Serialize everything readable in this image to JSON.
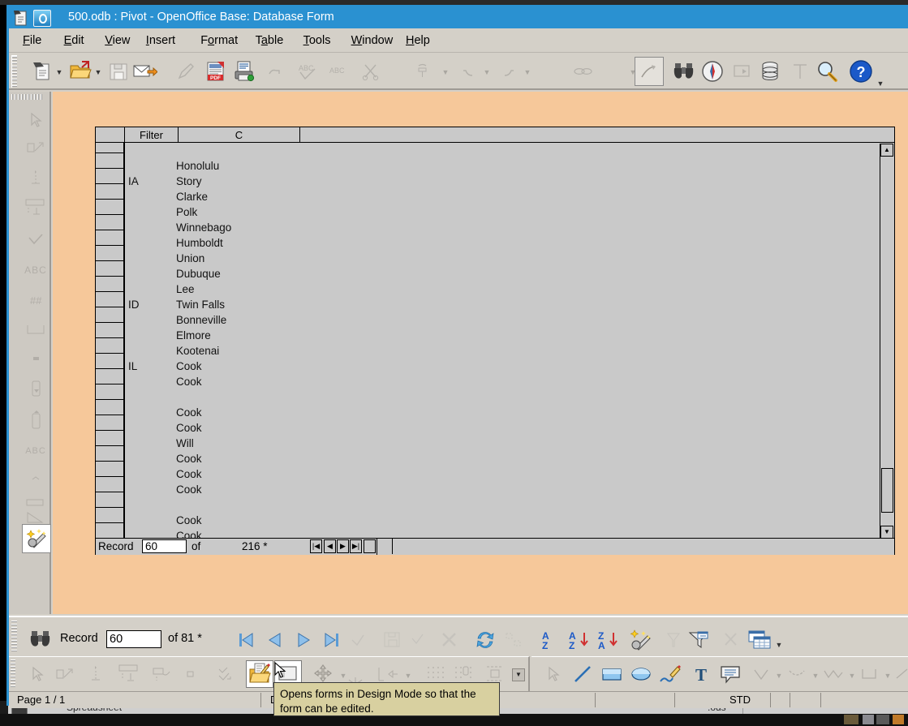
{
  "window": {
    "title": "500.odb : Pivot - OpenOffice Base: Database Form",
    "accent_color": "#2a91d1",
    "chrome_color": "#d4d0c8",
    "canvas_color": "#f6c89a"
  },
  "menubar": {
    "items": [
      {
        "label": "File",
        "accel": "F"
      },
      {
        "label": "Edit",
        "accel": "E"
      },
      {
        "label": "View",
        "accel": "V"
      },
      {
        "label": "Insert",
        "accel": "I"
      },
      {
        "label": "Format",
        "accel": "o"
      },
      {
        "label": "Table",
        "accel": "a"
      },
      {
        "label": "Tools",
        "accel": "T"
      },
      {
        "label": "Window",
        "accel": "W"
      },
      {
        "label": "Help",
        "accel": "H"
      }
    ]
  },
  "toolbar": {
    "buttons": [
      {
        "name": "new-document",
        "icon": "new-doc-icon",
        "enabled": true,
        "dropdown": true
      },
      {
        "name": "open-document",
        "icon": "open-folder-icon",
        "enabled": true,
        "dropdown": true
      },
      {
        "name": "save-document",
        "icon": "save-floppy-icon",
        "enabled": false,
        "dropdown": false
      },
      {
        "name": "send-email",
        "icon": "email-icon",
        "enabled": true,
        "dropdown": false
      },
      {
        "name": "edit-file",
        "icon": "edit-pencil-icon",
        "enabled": false,
        "dropdown": false
      },
      {
        "name": "export-pdf",
        "icon": "pdf-icon",
        "enabled": true,
        "dropdown": false
      },
      {
        "name": "print-file",
        "icon": "printer-icon",
        "enabled": true,
        "dropdown": false
      },
      {
        "name": "print-preview",
        "icon": "preview-icon",
        "enabled": false,
        "dropdown": false
      },
      {
        "name": "spelling",
        "icon": "abc-check-icon",
        "enabled": false,
        "dropdown": false
      },
      {
        "name": "autospellcheck",
        "icon": "abc-icon",
        "enabled": false,
        "dropdown": false
      },
      {
        "name": "cut",
        "icon": "scissors-icon",
        "enabled": false,
        "dropdown": false
      },
      {
        "name": "clone-formatting",
        "icon": "paintbrush-icon",
        "enabled": false,
        "dropdown": true
      },
      {
        "name": "undo",
        "icon": "undo-arrow-icon",
        "enabled": false,
        "dropdown": true
      },
      {
        "name": "redo",
        "icon": "redo-arrow-icon",
        "enabled": false,
        "dropdown": true
      },
      {
        "name": "hyperlink",
        "icon": "chain-link-icon",
        "enabled": false,
        "dropdown": true
      },
      {
        "name": "draw-functions",
        "icon": "draw-curve-icon",
        "enabled": true,
        "dropdown": false,
        "pressed": true
      },
      {
        "name": "find-and-replace",
        "icon": "binoculars-icon",
        "enabled": true,
        "dropdown": false
      },
      {
        "name": "navigator",
        "icon": "compass-icon",
        "enabled": true,
        "dropdown": false
      },
      {
        "name": "gallery",
        "icon": "gallery-icon",
        "enabled": false,
        "dropdown": false
      },
      {
        "name": "data-sources",
        "icon": "database-icon",
        "enabled": true,
        "dropdown": false
      },
      {
        "name": "formatting-marks",
        "icon": "pilcrow-icon",
        "enabled": false,
        "dropdown": false
      },
      {
        "name": "zoom",
        "icon": "magnifier-icon",
        "enabled": true,
        "dropdown": false
      },
      {
        "name": "help",
        "icon": "help-question-icon",
        "enabled": true,
        "dropdown": false
      }
    ],
    "overflow_label": "▼"
  },
  "left_toolbar": {
    "buttons": [
      {
        "name": "select-tool",
        "icon": "arrow-cursor-icon",
        "enabled": false
      },
      {
        "name": "design-mode-toggle",
        "icon": "design-mode-icon",
        "enabled": false
      },
      {
        "name": "label-field",
        "icon": "label-field-icon",
        "enabled": false
      },
      {
        "name": "text-box",
        "icon": "text-box-icon",
        "enabled": false
      },
      {
        "name": "check-box",
        "icon": "check-box-icon",
        "enabled": false
      },
      {
        "name": "formatted-field",
        "icon": "abc-field-icon",
        "enabled": false
      },
      {
        "name": "numeric-field",
        "icon": "numeric-field-icon",
        "enabled": false
      },
      {
        "name": "group-box",
        "icon": "group-box-icon",
        "enabled": false
      },
      {
        "name": "option-button",
        "icon": "option-button-icon",
        "enabled": false
      },
      {
        "name": "list-box",
        "icon": "list-box-icon",
        "enabled": false
      },
      {
        "name": "combo-box",
        "icon": "combo-box-icon",
        "enabled": false
      },
      {
        "name": "pattern-field",
        "icon": "pattern-field-icon",
        "enabled": false
      },
      {
        "name": "image-button",
        "icon": "image-button-icon",
        "enabled": false
      },
      {
        "name": "image-control",
        "icon": "image-control-icon",
        "enabled": false
      },
      {
        "name": "table-control",
        "icon": "table-control-icon",
        "enabled": false
      },
      {
        "name": "form-wizards",
        "icon": "magic-wand-icon",
        "enabled": true,
        "active": true
      }
    ],
    "expand_label": "▶"
  },
  "grid": {
    "columns": [
      {
        "key": "selector",
        "label": ""
      },
      {
        "key": "filter",
        "label": "Filter"
      },
      {
        "key": "c",
        "label": "C"
      },
      {
        "key": "blank",
        "label": ""
      }
    ],
    "rows": [
      {
        "filter": "",
        "c": ""
      },
      {
        "filter": "",
        "c": "Honolulu"
      },
      {
        "filter": "IA",
        "c": "Story"
      },
      {
        "filter": "",
        "c": "Clarke"
      },
      {
        "filter": "",
        "c": "Polk"
      },
      {
        "filter": "",
        "c": "Winnebago"
      },
      {
        "filter": "",
        "c": "Humboldt"
      },
      {
        "filter": "",
        "c": "Union"
      },
      {
        "filter": "",
        "c": "Dubuque"
      },
      {
        "filter": "",
        "c": "Lee"
      },
      {
        "filter": "ID",
        "c": "Twin Falls"
      },
      {
        "filter": "",
        "c": "Bonneville"
      },
      {
        "filter": "",
        "c": "Elmore"
      },
      {
        "filter": "",
        "c": "Kootenai"
      },
      {
        "filter": "IL",
        "c": "Cook"
      },
      {
        "filter": "",
        "c": "Cook"
      },
      {
        "filter": "",
        "c": ""
      },
      {
        "filter": "",
        "c": "Cook"
      },
      {
        "filter": "",
        "c": "Cook"
      },
      {
        "filter": "",
        "c": "Will"
      },
      {
        "filter": "",
        "c": "Cook"
      },
      {
        "filter": "",
        "c": "Cook"
      },
      {
        "filter": "",
        "c": "Cook"
      },
      {
        "filter": "",
        "c": ""
      },
      {
        "filter": "",
        "c": "Cook"
      },
      {
        "filter": "",
        "c": "Cook"
      }
    ],
    "navigation": {
      "record_label": "Record",
      "record_value": "60",
      "of_label": "of",
      "total": "216 *",
      "first_label": "⏮",
      "prev_label": "◀",
      "next_label": "▶",
      "last_label": "⏭"
    },
    "scrollbar": {
      "up_label": "▲",
      "down_label": "▼"
    }
  },
  "form_nav": {
    "search_icon": "binoculars-icon",
    "record_label": "Record",
    "record_value": "60",
    "of_label": "of 81 *",
    "buttons": [
      {
        "name": "first-record",
        "icon": "first-record-icon",
        "enabled": true
      },
      {
        "name": "previous-record",
        "icon": "prev-record-icon",
        "enabled": true
      },
      {
        "name": "next-record",
        "icon": "next-record-icon",
        "enabled": true
      },
      {
        "name": "last-record",
        "icon": "last-record-icon",
        "enabled": true
      },
      {
        "name": "new-record",
        "icon": "new-record-icon",
        "enabled": false
      },
      {
        "name": "save-record",
        "icon": "save-record-icon",
        "enabled": false
      },
      {
        "name": "undo-data-entry",
        "icon": "undo-entry-icon",
        "enabled": false
      },
      {
        "name": "delete-record",
        "icon": "delete-record-icon",
        "enabled": false
      },
      {
        "name": "refresh",
        "icon": "refresh-icon",
        "enabled": true
      },
      {
        "name": "refresh-control",
        "icon": "refresh-control-icon",
        "enabled": false
      },
      {
        "name": "sort",
        "icon": "sort-az-icon",
        "enabled": true
      },
      {
        "name": "sort-ascending",
        "icon": "sort-ascending-icon",
        "enabled": true
      },
      {
        "name": "sort-descending",
        "icon": "sort-descending-icon",
        "enabled": true
      },
      {
        "name": "autofilter",
        "icon": "autofilter-wand-icon",
        "enabled": true
      },
      {
        "name": "apply-filter",
        "icon": "apply-filter-icon",
        "enabled": false
      },
      {
        "name": "form-based-filter",
        "icon": "form-filter-icon",
        "enabled": true
      },
      {
        "name": "reset-filter",
        "icon": "reset-filter-icon",
        "enabled": false
      },
      {
        "name": "data-source-as-table",
        "icon": "data-table-icon",
        "enabled": true
      }
    ],
    "overflow_label": "▼"
  },
  "design_toolbar": {
    "buttons": [
      {
        "name": "select",
        "icon": "arrow-cursor-icon",
        "enabled": false
      },
      {
        "name": "design-mode",
        "icon": "design-mode-icon",
        "enabled": false
      },
      {
        "name": "control-properties",
        "icon": "properties-icon",
        "enabled": false
      },
      {
        "name": "form-properties",
        "icon": "form-properties-icon",
        "enabled": false
      },
      {
        "name": "form-navigator",
        "icon": "form-navigator-icon",
        "enabled": false
      },
      {
        "name": "add-field",
        "icon": "add-field-icon",
        "enabled": false
      },
      {
        "name": "activation-order",
        "icon": "activation-order-icon",
        "enabled": false
      },
      {
        "name": "open-in-design-mode",
        "icon": "open-design-folder-icon",
        "enabled": true,
        "selected": true
      },
      {
        "name": "toggle-design-mode",
        "icon": "toggle-design-icon",
        "enabled": true,
        "selected": true,
        "hovered": true
      },
      {
        "name": "position-and-size",
        "icon": "move-arrows-icon",
        "enabled": false,
        "dropdown": true
      },
      {
        "name": "anchor",
        "icon": "anchor-icon",
        "enabled": false,
        "dropdown": true
      },
      {
        "name": "align",
        "icon": "align-icon",
        "enabled": false,
        "dropdown": true
      },
      {
        "name": "display-grid",
        "icon": "display-grid-icon",
        "enabled": false
      },
      {
        "name": "snap-to-grid",
        "icon": "snap-grid-icon",
        "enabled": false
      },
      {
        "name": "helplines",
        "icon": "helplines-icon",
        "enabled": false
      }
    ],
    "overflow_label": "▼"
  },
  "drawing_toolbar": {
    "buttons": [
      {
        "name": "select",
        "icon": "arrow-cursor-icon",
        "enabled": false
      },
      {
        "name": "line",
        "icon": "line-icon",
        "enabled": true
      },
      {
        "name": "rectangle",
        "icon": "rectangle-icon",
        "enabled": true
      },
      {
        "name": "ellipse",
        "icon": "ellipse-icon",
        "enabled": true
      },
      {
        "name": "freeform-line",
        "icon": "freeform-line-icon",
        "enabled": true
      },
      {
        "name": "text-box",
        "icon": "text-T-icon",
        "enabled": true
      },
      {
        "name": "callouts",
        "icon": "callout-icon",
        "enabled": true
      },
      {
        "name": "basic-shapes",
        "icon": "basic-shapes-icon",
        "enabled": false,
        "dropdown": true
      },
      {
        "name": "symbol-shapes",
        "icon": "symbol-shapes-icon",
        "enabled": false,
        "dropdown": true
      },
      {
        "name": "block-arrows",
        "icon": "block-arrows-icon",
        "enabled": false,
        "dropdown": true
      },
      {
        "name": "flowchart",
        "icon": "flowchart-icon",
        "enabled": false,
        "dropdown": true
      },
      {
        "name": "stars",
        "icon": "stars-icon",
        "enabled": false
      }
    ]
  },
  "statusbar": {
    "page": "Page 1 / 1",
    "style": "De",
    "mode": "STD"
  },
  "tooltip": {
    "text": "Opens forms in Design Mode so that the form can be edited."
  },
  "background": {
    "spreadsheet_label": "Spreadsheet",
    "file_label": ".ods"
  }
}
